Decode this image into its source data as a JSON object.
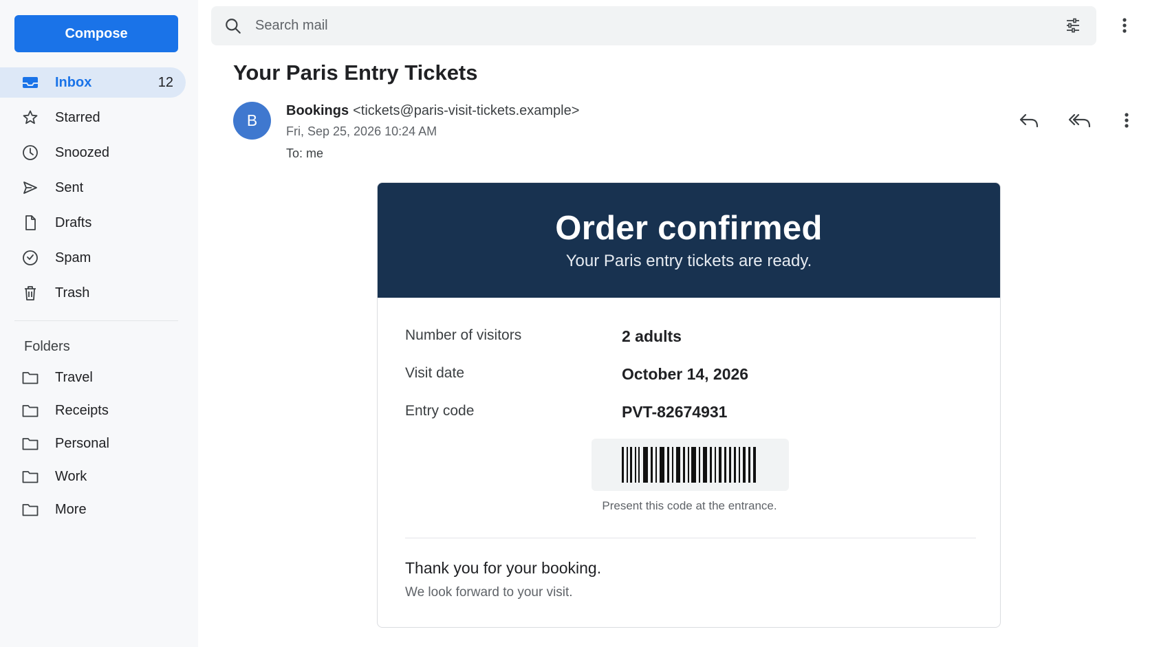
{
  "sidebar": {
    "compose_label": "Compose",
    "nav": [
      {
        "label": "Inbox",
        "icon": "inbox-icon",
        "count": "12",
        "active": true
      },
      {
        "label": "Starred",
        "icon": "star-icon"
      },
      {
        "label": "Snoozed",
        "icon": "clock-icon"
      },
      {
        "label": "Sent",
        "icon": "send-icon"
      },
      {
        "label": "Drafts",
        "icon": "draft-icon"
      },
      {
        "label": "Spam",
        "icon": "spam-icon"
      },
      {
        "label": "Trash",
        "icon": "trash-icon"
      }
    ],
    "folders_title": "Folders",
    "folders": [
      {
        "label": "Travel",
        "icon": "folder-icon"
      },
      {
        "label": "Receipts",
        "icon": "folder-icon"
      },
      {
        "label": "Personal",
        "icon": "folder-icon"
      },
      {
        "label": "Work",
        "icon": "folder-icon"
      },
      {
        "label": "More",
        "icon": "folder-icon"
      }
    ]
  },
  "search": {
    "placeholder": "Search mail"
  },
  "message": {
    "subject": "Your Paris Entry Tickets",
    "avatar_letter": "B",
    "sender_name": "Bookings",
    "sender_email": "<tickets@paris-visit-tickets.example>",
    "date": "Fri, Sep 25, 2026 10:24 AM",
    "to": "To: me"
  },
  "ticket": {
    "title": "Order confirmed",
    "subtitle": "Your Paris entry tickets are ready.",
    "rows": [
      {
        "label": "Number of visitors",
        "value": "2 adults"
      },
      {
        "label": "Visit date",
        "value": "October 14, 2026"
      },
      {
        "label": "Entry code",
        "value": "PVT-82674931"
      }
    ],
    "barcode_note": "Present this code at the entrance.",
    "thanks": "Thank you for your booking.",
    "closing": "We look forward to your visit."
  },
  "colors": {
    "accent": "#1a73e8",
    "active_nav_bg": "#dde8f7",
    "ticket_header_bg": "#183250",
    "avatar_bg": "#3f78cf"
  }
}
